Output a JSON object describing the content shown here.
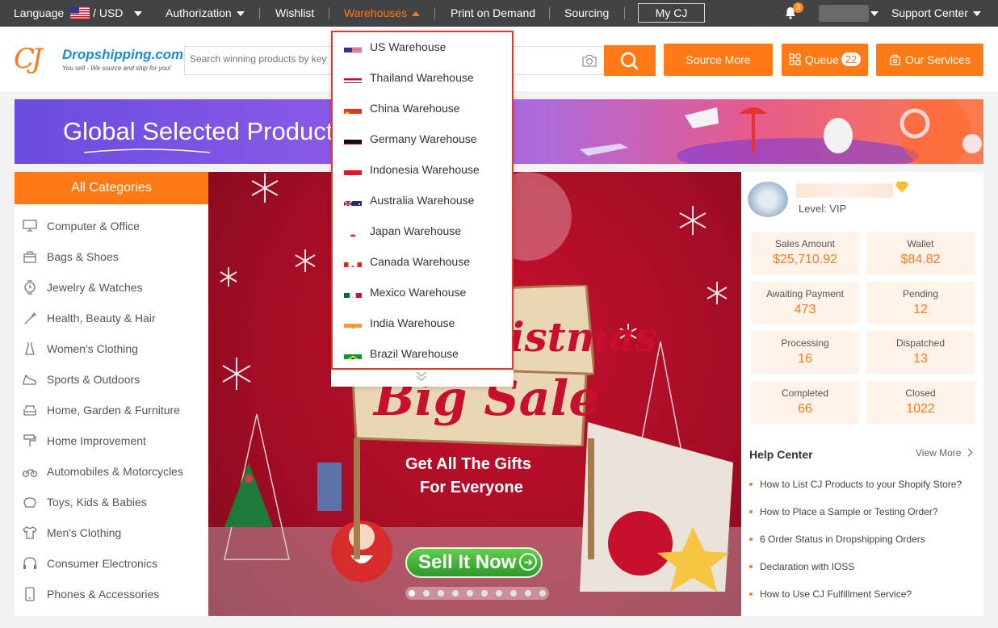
{
  "topbar": {
    "language": "Language",
    "currency": "USD",
    "authorization": "Authorization",
    "wishlist": "Wishlist",
    "warehouses": "Warehouses",
    "print_on_demand": "Print on Demand",
    "sourcing": "Sourcing",
    "my_cj": "My CJ",
    "notification_count": "3",
    "support_center": "Support Center"
  },
  "header": {
    "logo_mark": "CJ",
    "logo_brand": "Dropshipping.com",
    "logo_tagline": "You sell - We source and ship for you!",
    "search_placeholder": "Search winning products by keywords",
    "source_more": "Source More",
    "queue_label": "Queue",
    "queue_count": "22",
    "our_services": "Our Services"
  },
  "banner": {
    "title": "Global Selected Products"
  },
  "categories": {
    "title": "All Categories",
    "items": [
      {
        "label": "Computer & Office",
        "icon": "computer-icon"
      },
      {
        "label": "Bags & Shoes",
        "icon": "bag-icon"
      },
      {
        "label": "Jewelry & Watches",
        "icon": "watch-icon"
      },
      {
        "label": "Health, Beauty & Hair",
        "icon": "beauty-icon"
      },
      {
        "label": "Women's Clothing",
        "icon": "dress-icon"
      },
      {
        "label": "Sports & Outdoors",
        "icon": "shoe-icon"
      },
      {
        "label": "Home, Garden & Furniture",
        "icon": "sofa-icon"
      },
      {
        "label": "Home Improvement",
        "icon": "paint-roller-icon"
      },
      {
        "label": "Automobiles & Motorcycles",
        "icon": "motorcycle-icon"
      },
      {
        "label": "Toys, Kids & Babies",
        "icon": "toy-icon"
      },
      {
        "label": "Men's Clothing",
        "icon": "shirt-icon"
      },
      {
        "label": "Consumer Electronics",
        "icon": "headphones-icon"
      },
      {
        "label": "Phones & Accessories",
        "icon": "phone-icon"
      }
    ]
  },
  "hero": {
    "line1": "Christmas",
    "line2": "Big Sale",
    "line3": "Get All The Gifts",
    "line4": "For Everyone",
    "cta": "Sell It Now"
  },
  "warehouses_menu": {
    "items": [
      {
        "label": "US Warehouse",
        "flag": "us-flag-icon"
      },
      {
        "label": "Thailand Warehouse",
        "flag": "thailand-flag-icon"
      },
      {
        "label": "China Warehouse",
        "flag": "china-flag-icon"
      },
      {
        "label": "Germany Warehouse",
        "flag": "germany-flag-icon"
      },
      {
        "label": "Indonesia Warehouse",
        "flag": "indonesia-flag-icon"
      },
      {
        "label": "Australia Warehouse",
        "flag": "australia-flag-icon"
      },
      {
        "label": "Japan Warehouse",
        "flag": "japan-flag-icon"
      },
      {
        "label": "Canada Warehouse",
        "flag": "canada-flag-icon"
      },
      {
        "label": "Mexico Warehouse",
        "flag": "mexico-flag-icon"
      },
      {
        "label": "India Warehouse",
        "flag": "india-flag-icon"
      },
      {
        "label": "Brazil Warehouse",
        "flag": "brazil-flag-icon"
      }
    ]
  },
  "account": {
    "level": "Level: VIP",
    "stats": [
      {
        "label": "Sales Amount",
        "value": "$25,710.92"
      },
      {
        "label": "Wallet",
        "value": "$84.82"
      },
      {
        "label": "Awaiting Payment",
        "value": "473"
      },
      {
        "label": "Pending",
        "value": "12"
      },
      {
        "label": "Processing",
        "value": "16"
      },
      {
        "label": "Dispatched",
        "value": "13"
      },
      {
        "label": "Completed",
        "value": "66"
      },
      {
        "label": "Closed",
        "value": "1022"
      }
    ]
  },
  "help": {
    "title": "Help Center",
    "view_more": "View More",
    "items": [
      "How to List CJ Products to your Shopify Store?",
      "How to Place a Sample or Testing Order?",
      "6 Order Status in Dropshipping Orders",
      "Declaration with IOSS",
      "How to Use CJ Fulfillment Service?"
    ]
  },
  "colors": {
    "accent": "#ff7a14",
    "topbar": "#424345",
    "dropdown_border": "#e8372a"
  }
}
